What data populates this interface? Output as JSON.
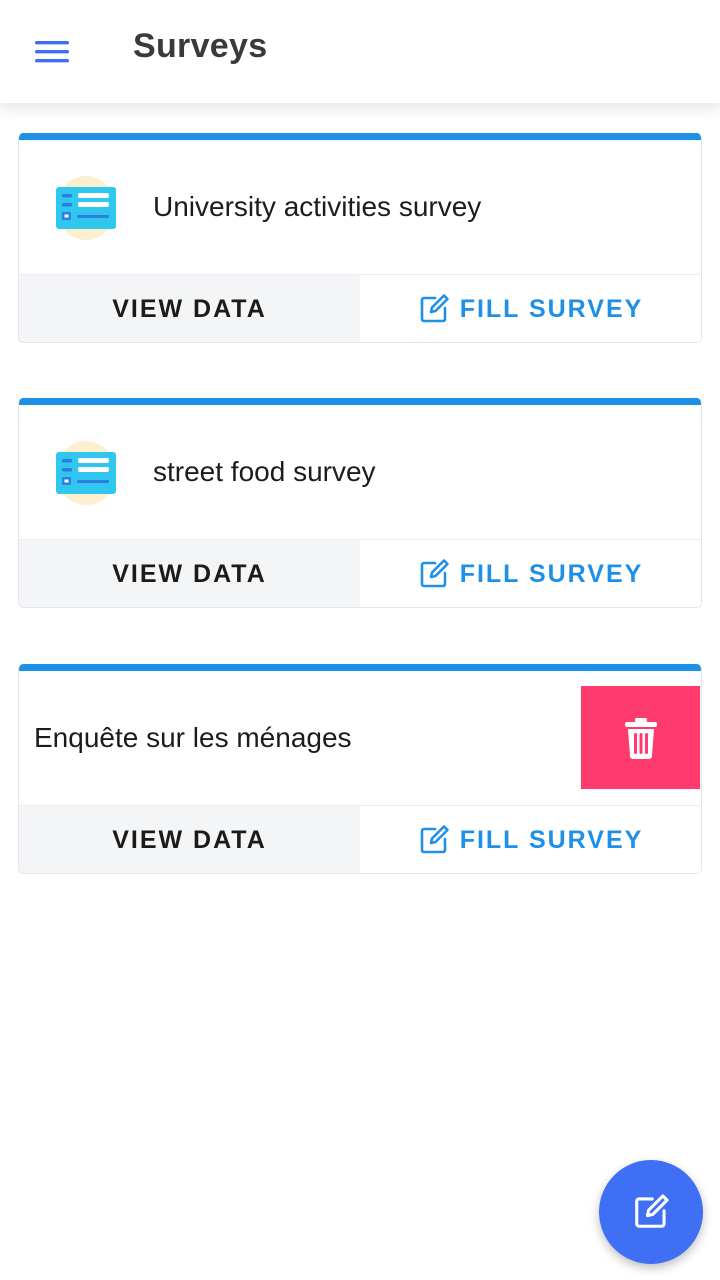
{
  "header": {
    "title": "Surveys",
    "menu_icon": "hamburger-menu-icon"
  },
  "colors": {
    "accent": "#1e90e8",
    "fab": "#3f6ff5",
    "delete": "#ff3b6e",
    "view_data_bg": "#f4f5f7"
  },
  "surveys": [
    {
      "title": "University activities survey",
      "icon": "form-icon",
      "view_label": "VIEW DATA",
      "fill_label": "FILL SURVEY"
    },
    {
      "title": "street food survey",
      "icon": "form-icon",
      "view_label": "VIEW DATA",
      "fill_label": "FILL SURVEY"
    },
    {
      "title": "Enquête sur les ménages",
      "icon": "trash-icon",
      "view_label": "VIEW DATA",
      "fill_label": "FILL SURVEY"
    }
  ],
  "fab": {
    "icon": "new-survey-edit-icon"
  }
}
